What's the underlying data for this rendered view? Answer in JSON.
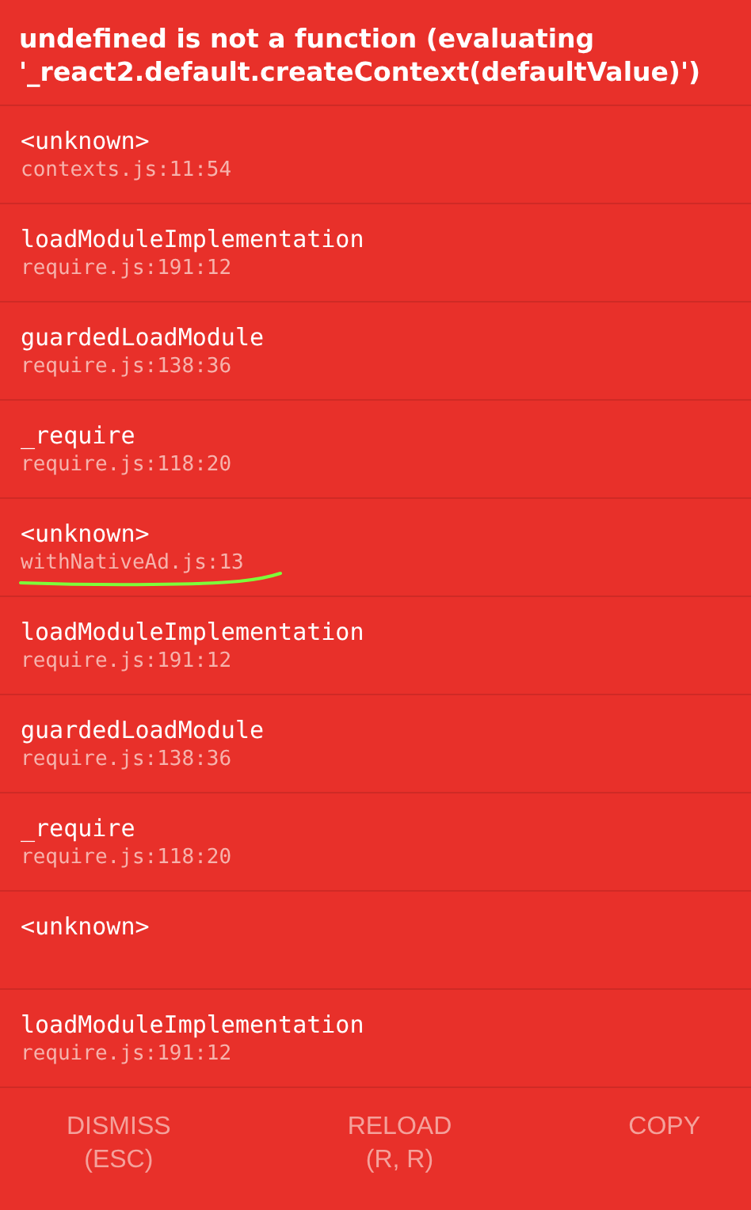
{
  "title": "undefined is not a function (evaluating '_react2.default.createContext(defaultValue)')",
  "frames": [
    {
      "method": "<unknown>",
      "location": "contexts.js:11:54",
      "underlined": false
    },
    {
      "method": "loadModuleImplementation",
      "location": "require.js:191:12",
      "underlined": false
    },
    {
      "method": "guardedLoadModule",
      "location": "require.js:138:36",
      "underlined": false
    },
    {
      "method": "_require",
      "location": "require.js:118:20",
      "underlined": false
    },
    {
      "method": "<unknown>",
      "location": "withNativeAd.js:13",
      "underlined": true
    },
    {
      "method": "loadModuleImplementation",
      "location": "require.js:191:12",
      "underlined": false
    },
    {
      "method": "guardedLoadModule",
      "location": "require.js:138:36",
      "underlined": false
    },
    {
      "method": "_require",
      "location": "require.js:118:20",
      "underlined": false
    },
    {
      "method": "<unknown>",
      "underlined": false
    },
    {
      "method": "loadModuleImplementation",
      "location": "require.js:191:12",
      "underlined": false
    }
  ],
  "buttons": [
    {
      "label": "DISMISS",
      "shortcut": "(ESC)"
    },
    {
      "label": "RELOAD",
      "shortcut": "(R, R)"
    },
    {
      "label": "COPY"
    }
  ]
}
